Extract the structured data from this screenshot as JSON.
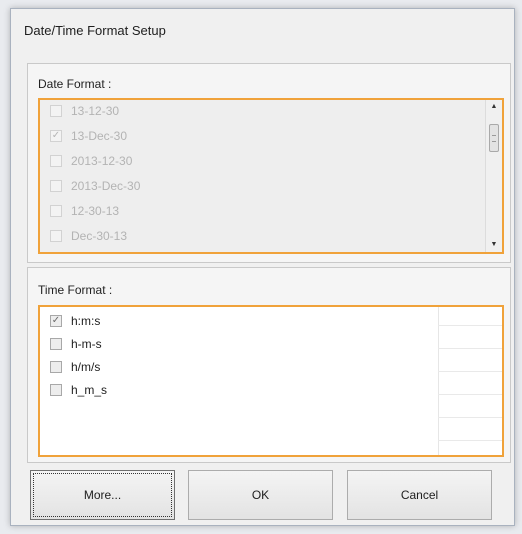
{
  "window": {
    "title": "Date/Time Format Setup"
  },
  "date_group": {
    "label": "Date Format :",
    "items": [
      {
        "label": "13-12-30",
        "checked": false
      },
      {
        "label": "13-Dec-30",
        "checked": true
      },
      {
        "label": "2013-12-30",
        "checked": false
      },
      {
        "label": "2013-Dec-30",
        "checked": false
      },
      {
        "label": "12-30-13",
        "checked": false
      },
      {
        "label": "Dec-30-13",
        "checked": false
      }
    ]
  },
  "time_group": {
    "label": "Time Format :",
    "items": [
      {
        "label": "h:m:s",
        "checked": true
      },
      {
        "label": "h-m-s",
        "checked": false
      },
      {
        "label": "h/m/s",
        "checked": false
      },
      {
        "label": "h_m_s",
        "checked": false
      }
    ]
  },
  "buttons": {
    "more": "More...",
    "ok": "OK",
    "cancel": "Cancel"
  },
  "glyphs": {
    "check": "✓",
    "scroll_up": "▲",
    "scroll_down": "▼"
  },
  "colors": {
    "focus_border": "#f0a23a"
  }
}
